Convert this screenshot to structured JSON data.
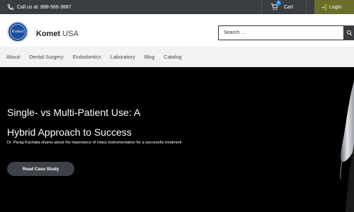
{
  "topbar": {
    "phone_text": "Call us at: 888-566-3887",
    "cart_label": "Cart",
    "cart_count": "0",
    "login_label": "Login"
  },
  "header": {
    "logo_text": "Komet",
    "brand_name": "Komet",
    "brand_region": "USA",
    "search_placeholder": "Search ..."
  },
  "nav": {
    "items": [
      "About",
      "Dental Surgery",
      "Endodontics",
      "Laboratory",
      "Blog",
      "Catalog"
    ]
  },
  "hero": {
    "title_line1": "Single- vs Multi-Patient Use: A",
    "title_line2": "Hybrid Approach to Success",
    "subtitle": "Dr. Parag Kachalia shares about the importance of rotary instrumentation for a successful treatment",
    "cta_label": "Read Case Study"
  },
  "colors": {
    "topbar_bg": "#3a3d40",
    "login_bg": "#6a6e2a",
    "nav_bg": "#f2f2f2",
    "hero_bg": "#000000",
    "brand_blue": "#1a4f9c",
    "cart_badge": "#1e88e5"
  },
  "icons": {
    "phone": "phone-icon",
    "cart": "cart-icon",
    "login": "login-icon",
    "search": "search-icon"
  }
}
